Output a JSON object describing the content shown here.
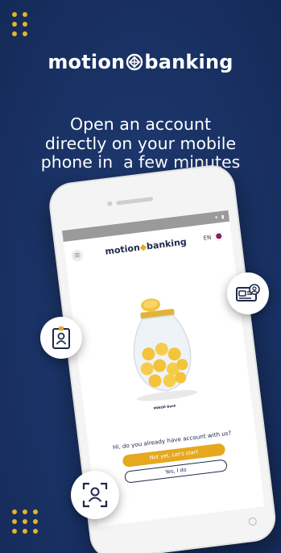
{
  "brand": {
    "left": "motion",
    "right": "banking"
  },
  "headline": {
    "lines": [
      "Open an account",
      "directly on your mobile",
      "phone in  a few minutes"
    ]
  },
  "phone": {
    "app_logo_left": "motion",
    "app_logo_right": "banking",
    "language": "EN",
    "small_brand": "MINOR Bank",
    "question": "Hi, do you already have account with us?",
    "primary_button": "Not yet, Let's start",
    "secondary_button": "Yes, I do"
  },
  "colors": {
    "background": "#1b3468",
    "accent": "#e5b42c",
    "text": "#ffffff"
  },
  "icons": [
    "logo-mark-icon",
    "id-badge-icon",
    "id-card-icon",
    "face-scan-icon",
    "coin-jar-icon",
    "menu-icon",
    "uk-flag-icon"
  ]
}
